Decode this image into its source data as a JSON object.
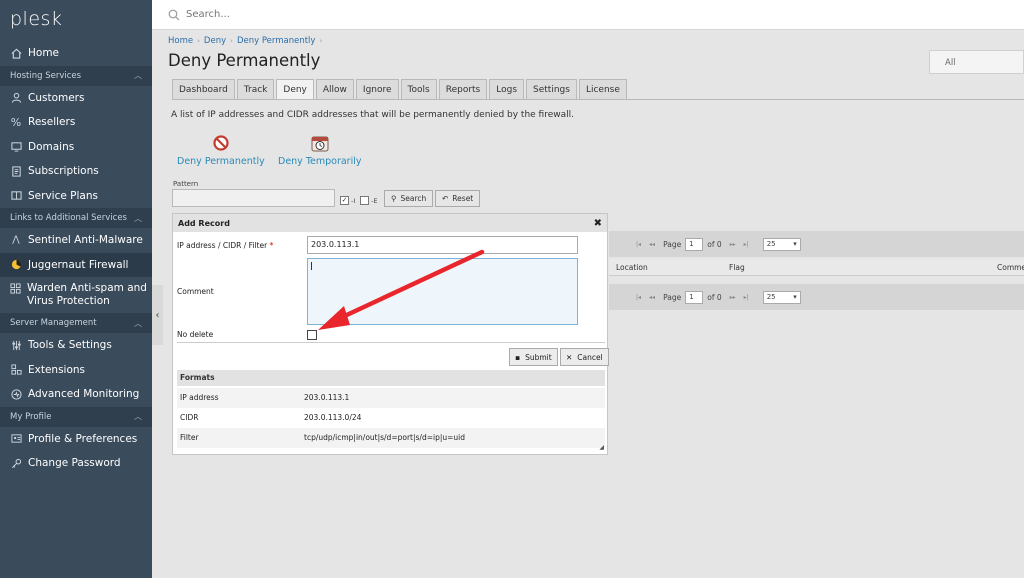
{
  "app": {
    "logo": "plesk"
  },
  "sidebar": {
    "home": "Home",
    "sections": [
      {
        "title": "Hosting Services",
        "items": [
          "Customers",
          "Resellers",
          "Domains",
          "Subscriptions",
          "Service Plans"
        ]
      },
      {
        "title": "Links to Additional Services",
        "items": [
          "Sentinel Anti-Malware",
          "Juggernaut Firewall",
          "Warden Anti-spam and Virus Protection"
        ]
      },
      {
        "title": "Server Management",
        "items": [
          "Tools & Settings",
          "Extensions",
          "Advanced Monitoring"
        ]
      },
      {
        "title": "My Profile",
        "items": [
          "Profile & Preferences",
          "Change Password"
        ]
      }
    ]
  },
  "search": {
    "placeholder": "Search..."
  },
  "breadcrumb": [
    "Home",
    "Deny",
    "Deny Permanently"
  ],
  "page": {
    "title": "Deny Permanently",
    "filter_select": "All",
    "description": "A list of IP addresses and CIDR addresses that will be permanently denied by the firewall."
  },
  "tabs": [
    "Dashboard",
    "Track",
    "Deny",
    "Allow",
    "Ignore",
    "Tools",
    "Reports",
    "Logs",
    "Settings",
    "License"
  ],
  "actions": {
    "deny_permanently": "Deny Permanently",
    "deny_temporarily": "Deny Temporarily"
  },
  "pattern": {
    "label": "Pattern",
    "opt_i": "-I",
    "opt_e": "-E",
    "search": "Search",
    "reset": "Reset"
  },
  "grid": {
    "page_label": "Page",
    "page_value": "1",
    "of_label": "of 0",
    "per_page": "25",
    "columns": [
      "Location",
      "Flag",
      "Comme"
    ]
  },
  "dialog": {
    "title": "Add Record",
    "ip_label": "IP address / CIDR / Filter",
    "required_mark": "*",
    "ip_value": "203.0.113.1",
    "comment_label": "Comment",
    "nodelete_label": "No delete",
    "submit": "Submit",
    "cancel": "Cancel",
    "formats_title": "Formats",
    "formats": [
      {
        "k": "IP address",
        "v": "203.0.113.1"
      },
      {
        "k": "CIDR",
        "v": "203.0.113.0/24"
      },
      {
        "k": "Filter",
        "v": "tcp/udp/icmp|in/out|s/d=port|s/d=ip|u=uid"
      }
    ]
  },
  "colors": {
    "sidebar": "#3a4b5c",
    "link": "#2a8ab8",
    "arrow": "#e8262b"
  }
}
